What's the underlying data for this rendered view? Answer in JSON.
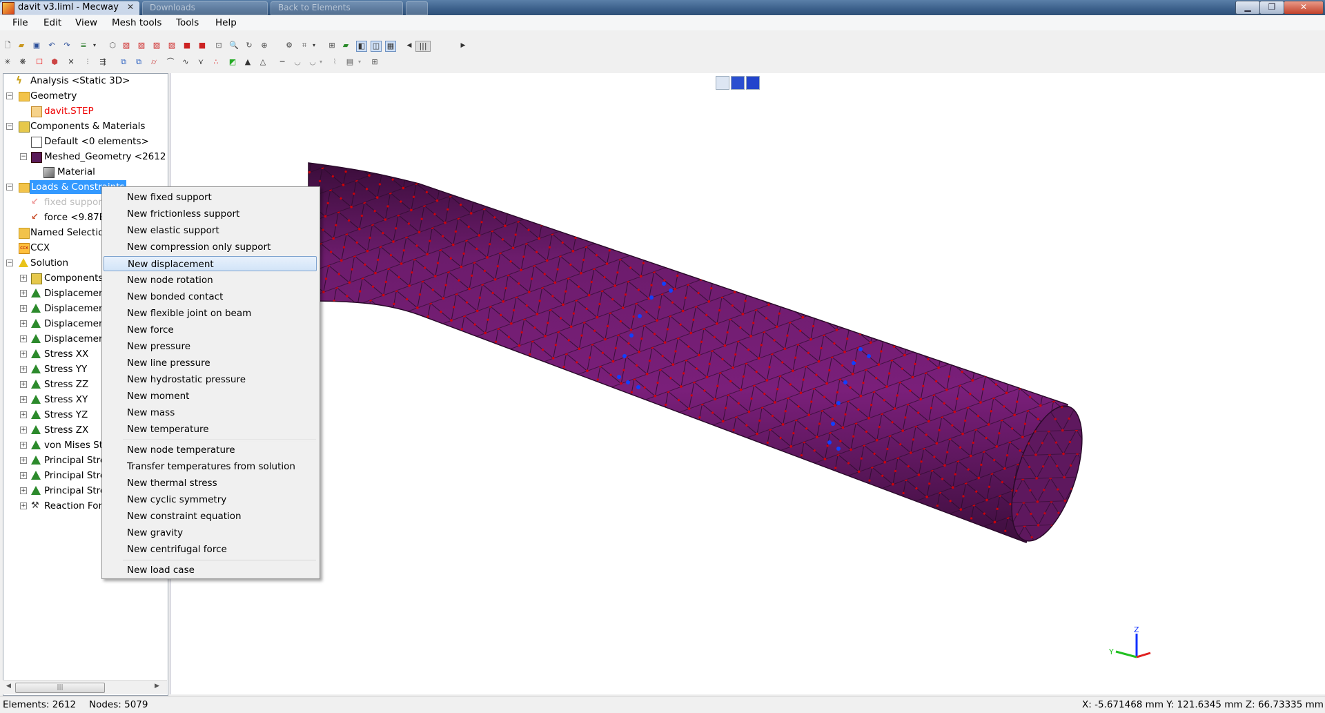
{
  "window": {
    "title": "davit v3.liml - Mecway",
    "bg_tabs": [
      "Downloads",
      "Back to Elements"
    ]
  },
  "menubar": [
    "File",
    "Edit",
    "View",
    "Mesh tools",
    "Tools",
    "Help"
  ],
  "tree": {
    "analysis": "Analysis <Static 3D>",
    "geometry": "Geometry",
    "geometry_file": "davit.STEP",
    "components": "Components & Materials",
    "default_comp": "Default <0 elements>",
    "meshed_geom": "Meshed_Geometry <2612",
    "material": "Material",
    "loads": "Loads & Constraints",
    "fixed_support": "fixed suppor",
    "force": "force <9.87E",
    "named_selections": "Named Selectio",
    "ccx": "CCX",
    "solution": "Solution",
    "solution_items": [
      "Components",
      "Displacemer",
      "Displacemer",
      "Displacemer",
      "Displacemer",
      "Stress XX",
      "Stress YY",
      "Stress ZZ",
      "Stress XY",
      "Stress YZ",
      "Stress ZX",
      "von Mises St",
      "Principal Stre",
      "Principal Stre",
      "Principal Stre",
      "Reaction For"
    ]
  },
  "context_menu": {
    "group1": [
      "New fixed support",
      "New frictionless support",
      "New elastic support",
      "New compression only support",
      "New displacement",
      "New node rotation",
      "New bonded contact",
      "New flexible joint on beam",
      "New force",
      "New pressure",
      "New line pressure",
      "New hydrostatic pressure",
      "New moment",
      "New mass",
      "New temperature"
    ],
    "group2": [
      "New node temperature",
      "Transfer temperatures from solution",
      "New thermal stress",
      "New cyclic symmetry",
      "New constraint equation",
      "New gravity",
      "New centrifugal force"
    ],
    "group3": [
      "New load case"
    ],
    "hovered": "New displacement"
  },
  "statusbar": {
    "elements": "Elements:  2612",
    "nodes": "Nodes: 5079",
    "coords": "X: -5.671468 mm Y: 121.6345 mm Z: 66.73335 mm"
  },
  "axis_labels": {
    "z": "Z",
    "y": "Y"
  },
  "colors": {
    "mesh_fill": "#6a1a6a",
    "node_red": "#e00000",
    "node_blue": "#1040ff",
    "selection": "#3399ff"
  }
}
